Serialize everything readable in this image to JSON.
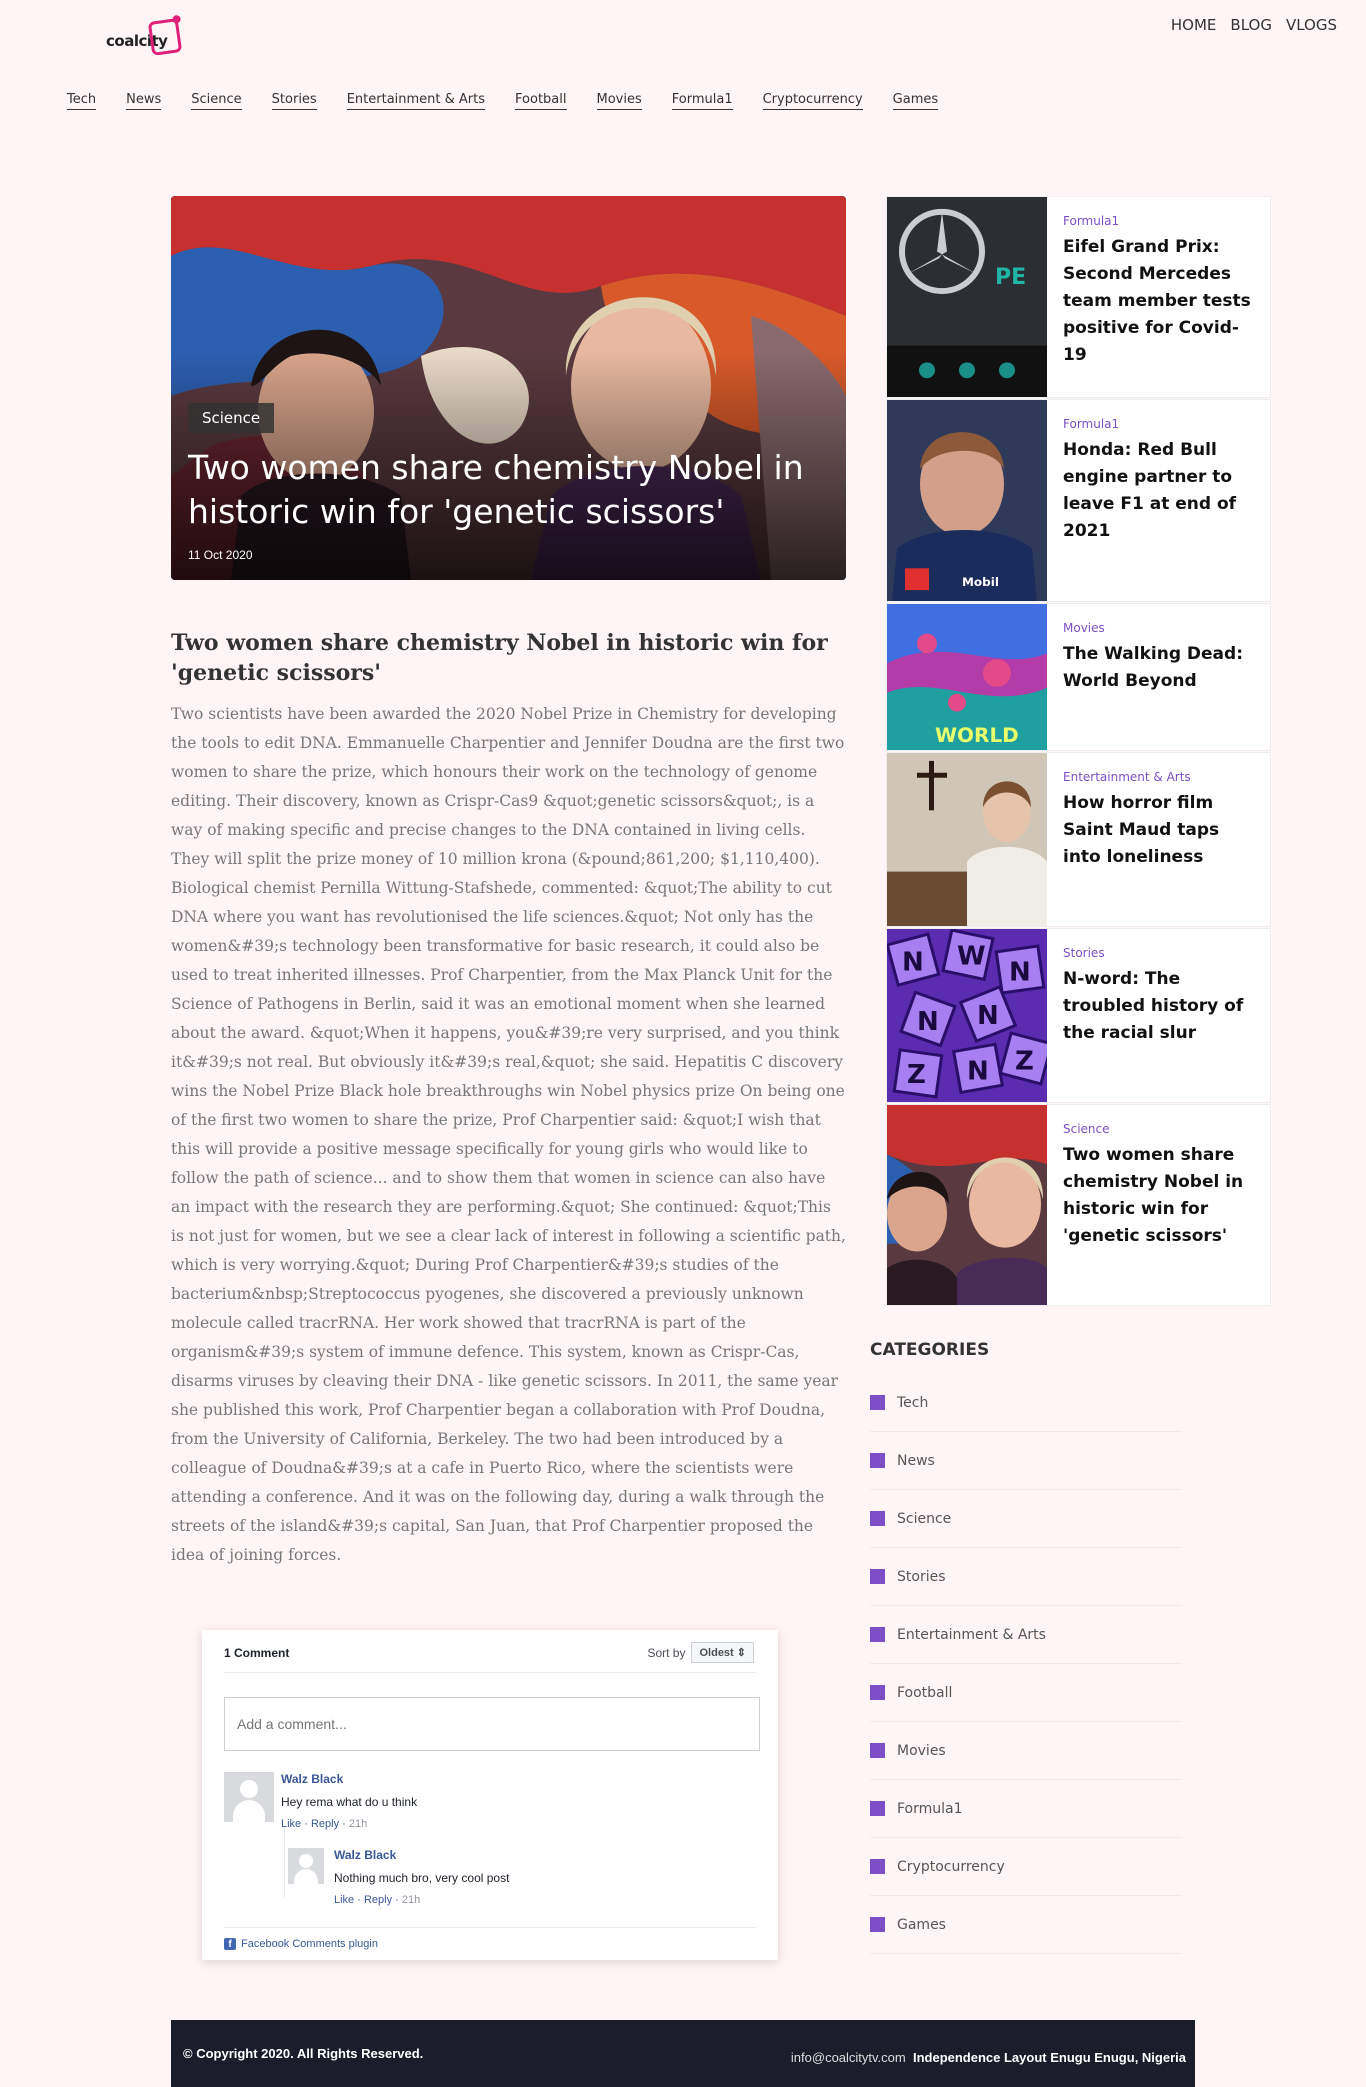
{
  "brand": {
    "logo_text": "coalcity"
  },
  "top_nav": [
    {
      "label": "HOME"
    },
    {
      "label": "BLOG"
    },
    {
      "label": "VLOGS"
    }
  ],
  "category_nav": [
    "Tech",
    "News",
    "Science",
    "Stories",
    "Entertainment & Arts",
    "Football",
    "Movies",
    "Formula1",
    "Cryptocurrency",
    "Games"
  ],
  "hero": {
    "category": "Science",
    "title": "Two women share chemistry Nobel in historic win for 'genetic scissors'",
    "date": "11 Oct 2020"
  },
  "article": {
    "title": "Two women share chemistry Nobel in historic win for 'genetic scissors'",
    "body": "Two scientists have been awarded the 2020 Nobel Prize in Chemistry for developing the tools to edit DNA. Emmanuelle Charpentier and Jennifer Doudna are the first two women to share the prize, which honours their work on the technology of genome editing. Their discovery, known as Crispr-Cas9 &quot;genetic scissors&quot;, is a way of making specific and precise changes to the DNA contained in living cells. They will split the prize money of 10 million krona (&pound;861,200; $1,110,400). Biological chemist Pernilla Wittung-Stafshede, commented: &quot;The ability to cut DNA where you want has revolutionised the life sciences.&quot; Not only has the women&#39;s technology been transformative for basic research, it could also be used to treat inherited illnesses. Prof Charpentier, from the Max Planck Unit for the Science of Pathogens in Berlin, said it was an emotional moment when she learned about the award. &quot;When it happens, you&#39;re very surprised, and you think it&#39;s not real. But obviously it&#39;s real,&quot; she said. Hepatitis C discovery wins the Nobel Prize Black hole breakthroughs win Nobel physics prize On being one of the first two women to share the prize, Prof Charpentier said: &quot;I wish that this will provide a positive message specifically for young girls who would like to follow the path of science... and to show them that women in science can also have an impact with the research they are performing.&quot; She continued: &quot;This is not just for women, but we see a clear lack of interest in following a scientific path, which is very worrying.&quot; During Prof Charpentier&#39;s studies of the bacterium&nbsp;Streptococcus pyogenes, she discovered a previously unknown molecule called tracrRNA. Her work showed that tracrRNA is part of the organism&#39;s system of immune defence. This system, known as Crispr-Cas, disarms viruses by cleaving their DNA - like genetic scissors. In 2011, the same year she published this work, Prof Charpentier began a collaboration with Prof Doudna, from the University of California, Berkeley. The two had been introduced by a colleague of Doudna&#39;s at a cafe in Puerto Rico, where the scientists were attending a conference. And it was on the following day, during a walk through the streets of the island&#39;s capital, San Juan, that Prof Charpentier proposed the idea of joining forces."
  },
  "comments": {
    "count_label": "1 Comment",
    "sort_label": "Sort by",
    "sort_value": "Oldest ⇕",
    "input_placeholder": "Add a comment...",
    "items": [
      {
        "name": "Walz Black",
        "text": "Hey rema what do u think",
        "like": "Like",
        "reply": "Reply",
        "time": "21h"
      },
      {
        "name": "Walz Black",
        "text": "Nothing much bro, very cool post",
        "like": "Like",
        "reply": "Reply",
        "time": "21h"
      }
    ],
    "plugin_label": "Facebook Comments plugin"
  },
  "side_cards": [
    {
      "category": "Formula1",
      "title": "Eifel Grand Prix: Second Mercedes team member tests positive for Covid-19"
    },
    {
      "category": "Formula1",
      "title": "Honda: Red Bull engine partner to leave F1 at end of 2021"
    },
    {
      "category": "Movies",
      "title": "The Walking Dead: World Beyond"
    },
    {
      "category": "Entertainment & Arts",
      "title": "How horror film Saint Maud taps into loneliness"
    },
    {
      "category": "Stories",
      "title": "N-word: The troubled history of the racial slur"
    },
    {
      "category": "Science",
      "title": "Two women share chemistry Nobel in historic win for 'genetic scissors'"
    }
  ],
  "categories": {
    "heading": "CATEGORIES",
    "items": [
      "Tech",
      "News",
      "Science",
      "Stories",
      "Entertainment & Arts",
      "Football",
      "Movies",
      "Formula1",
      "Cryptocurrency",
      "Games"
    ]
  },
  "footer": {
    "copyright": "© Copyright 2020. All Rights Reserved.",
    "email": "info@coalcitytv.com",
    "address": "Independence Layout Enugu Enugu, Nigeria"
  },
  "colors": {
    "accent": "#7e4ec6",
    "background": "#fff5f7",
    "footer": "#1b1d2a"
  }
}
